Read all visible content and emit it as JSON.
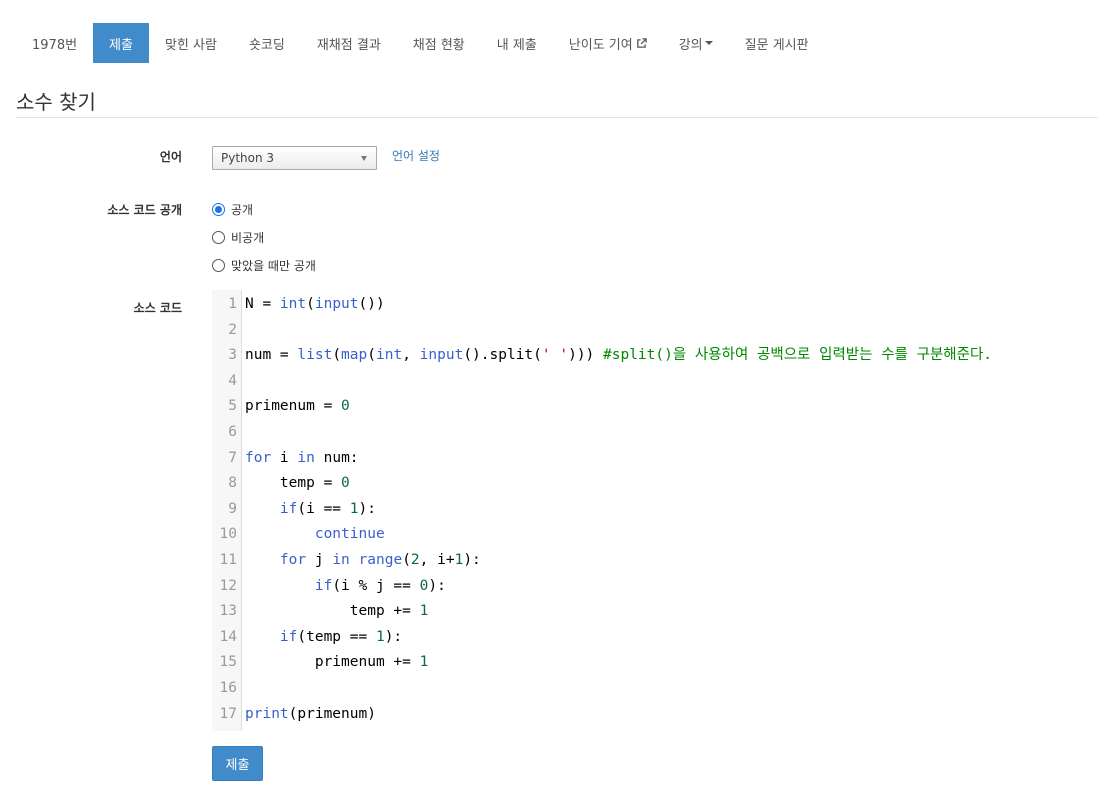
{
  "tabs": [
    {
      "label": "1978번"
    },
    {
      "label": "제출",
      "active": true
    },
    {
      "label": "맞힌 사람"
    },
    {
      "label": "숏코딩"
    },
    {
      "label": "재채점 결과"
    },
    {
      "label": "채점 현황"
    },
    {
      "label": "내 제출"
    },
    {
      "label": "난이도 기여"
    },
    {
      "label": "강의"
    },
    {
      "label": "질문 게시판"
    }
  ],
  "page": {
    "title": "소수 찾기"
  },
  "form": {
    "language_label": "언어",
    "language_value": "Python 3",
    "language_settings_link": "언어 설정",
    "visibility_label": "소스 코드 공개",
    "visibility_options": [
      {
        "label": "공개",
        "checked": true
      },
      {
        "label": "비공개",
        "checked": false
      },
      {
        "label": "맞았을 때만 공개",
        "checked": false
      }
    ],
    "source_label": "소스 코드",
    "submit_label": "제출"
  },
  "code": {
    "language": "python",
    "line_numbers": [
      "1",
      "2",
      "3",
      "4",
      "5",
      "6",
      "7",
      "8",
      "9",
      "10",
      "11",
      "12",
      "13",
      "14",
      "15",
      "16",
      "17"
    ],
    "lines": [
      "N = int(input())",
      "",
      "num = list(map(int, input().split(' '))) #split()을 사용하여 공백으로 입력받는 수를 구분해준다.",
      "",
      "primenum = 0",
      "",
      "for i in num:",
      "    temp = 0",
      "    if(i == 1):",
      "        continue",
      "    for j in range(2, i+1):",
      "        if(i % j == 0):",
      "            temp += 1",
      "    if(temp == 1):",
      "        primenum += 1",
      "",
      "print(primenum)"
    ]
  },
  "colors": {
    "accent": "#428bca",
    "link": "#337ab7",
    "keyword": "#3a5fcd",
    "number": "#116644",
    "string": "#aa1111",
    "comment": "#008800"
  },
  "icons": {
    "external_link": "external-link-icon",
    "dropdown": "caret-down-icon",
    "select_arrow": "chevron-down-icon"
  }
}
